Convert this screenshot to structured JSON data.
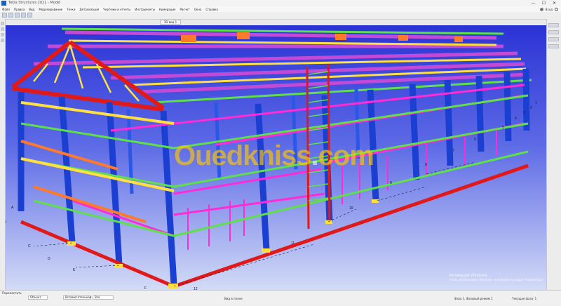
{
  "window": {
    "title": "Tekla Structures 2021 - Model",
    "minimize": "—",
    "maximize": "☐",
    "close": "✕"
  },
  "menu": {
    "items": [
      "Файл",
      "Правка",
      "Вид",
      "Моделирование",
      "Точки",
      "Детализация",
      "Чертежи и отчеты",
      "Инструменты",
      "Нумерация",
      "Расчет",
      "Окна",
      "Справка"
    ],
    "user": "Вход"
  },
  "tab": {
    "label": "3D вид 1"
  },
  "watermark": {
    "brand": "Ouedkniss",
    "dot": ".",
    "tld": "com"
  },
  "activation": {
    "line1": "Активация Windows",
    "line2": "Чтобы активировать Windows, перейдите в раздел \"Параметры\"."
  },
  "grid_labels": [
    "1",
    "2",
    "3",
    "4",
    "5",
    "6",
    "7",
    "8",
    "9",
    "10",
    "11",
    "12",
    "A",
    "B",
    "C",
    "D",
    "E",
    "F"
  ],
  "status": {
    "left": "Переместить",
    "fields": [
      "Объект",
      "Вспомогательная",
      "Все"
    ],
    "center": "Вид в плане",
    "right1": "Фаза 1, Фазовый режим 1",
    "right2": "Текущая фаза: 1"
  },
  "colors": {
    "sky_top": "#2c36d6",
    "sky_bottom": "#cdd6f5",
    "column": "#1a3fd1",
    "rafter": "#e01a1a",
    "purlin": "#c24ad6",
    "girt": "#5fe04a",
    "brace": "#ffe040",
    "accent_orange": "#ff7a2a",
    "magenta": "#ff2bd6"
  }
}
